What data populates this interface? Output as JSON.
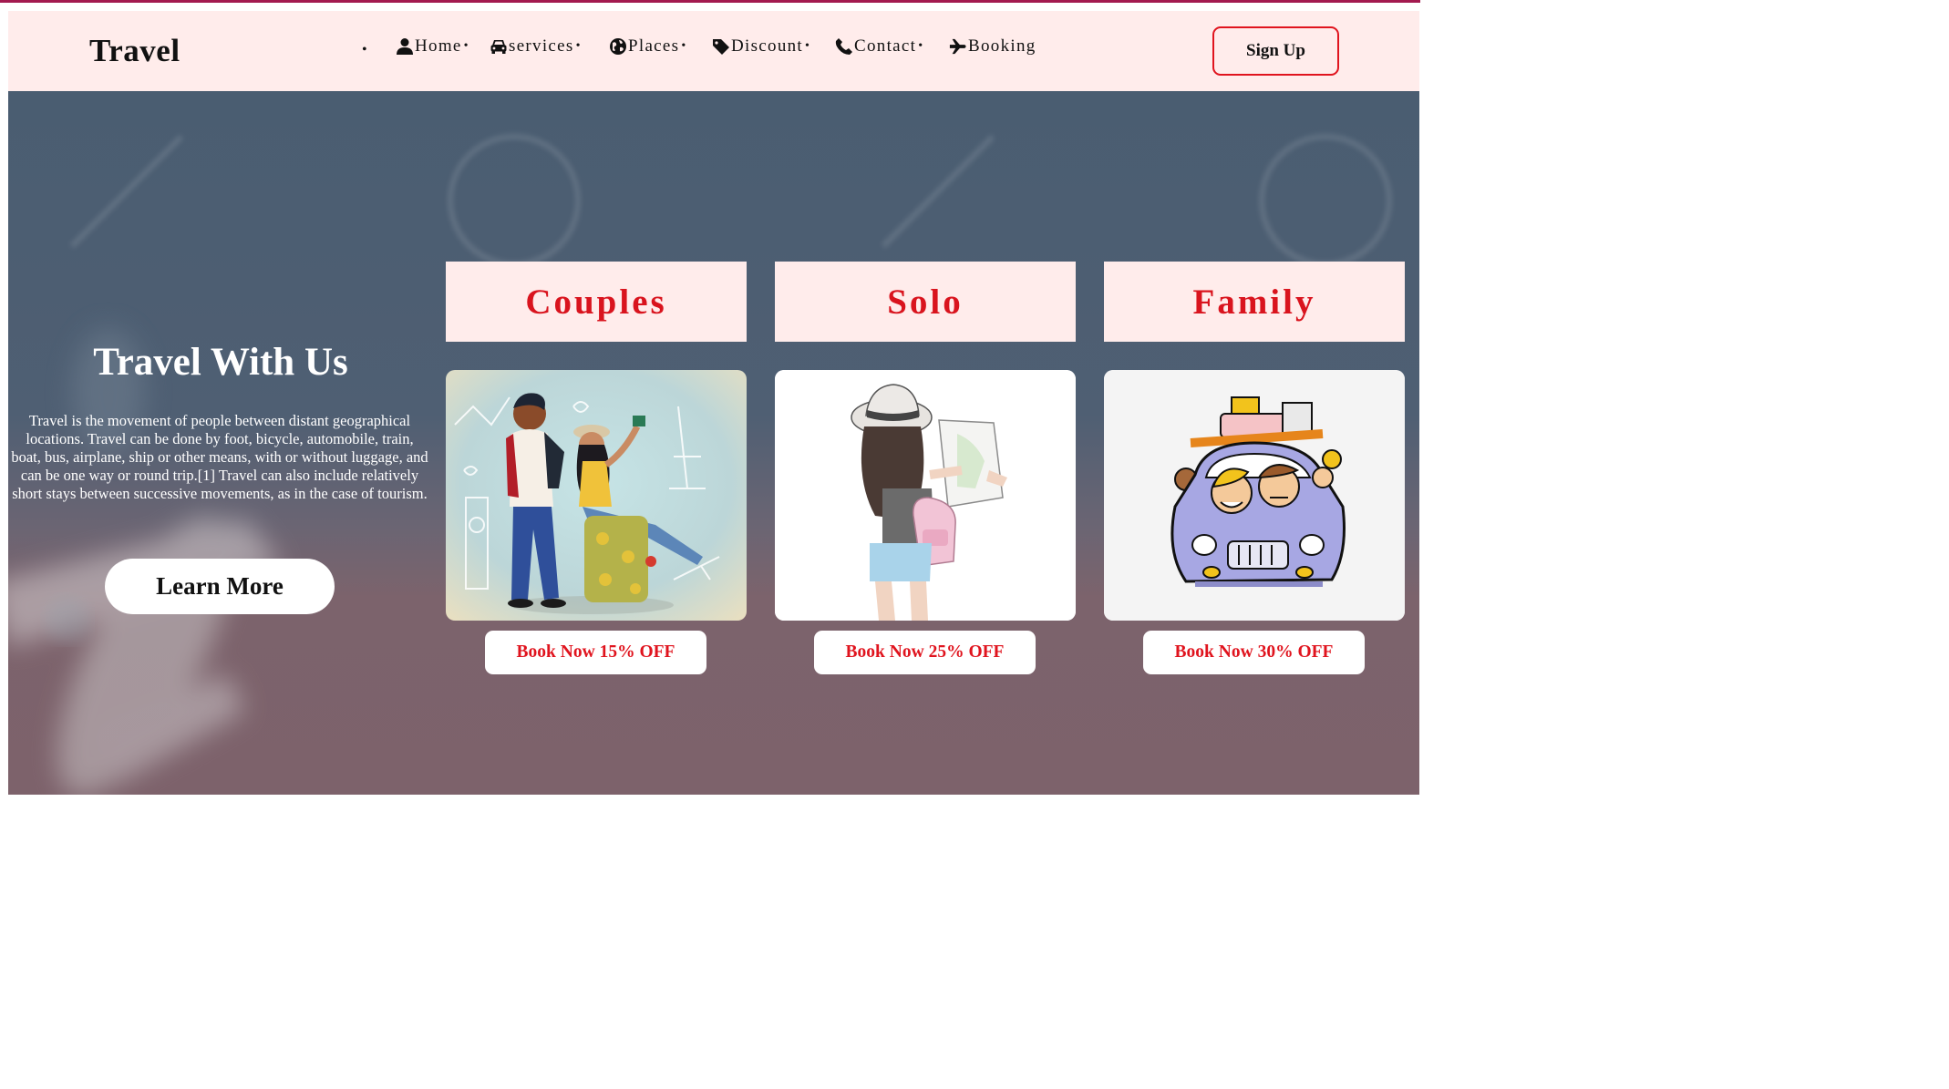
{
  "brand": "Travel",
  "nav": {
    "items": [
      {
        "label": "Home",
        "icon": "user-icon"
      },
      {
        "label": "services",
        "icon": "car-icon"
      },
      {
        "label": "Places",
        "icon": "globe-icon"
      },
      {
        "label": "Discount",
        "icon": "tag-icon"
      },
      {
        "label": "Contact",
        "icon": "phone-icon"
      },
      {
        "label": "Booking",
        "icon": "plane-icon"
      }
    ],
    "signup_label": "Sign Up"
  },
  "hero": {
    "title": "Travel With Us",
    "text": "Travel is the movement of people between distant geographical locations. Travel can be done by foot, bicycle, automobile, train, boat, bus, airplane, ship or other means, with or without luggage, and can be one way or round trip.[1] Travel can also include relatively short stays between successive movements, as in the case of tourism.",
    "button_label": "Learn More"
  },
  "cards": [
    {
      "title": "Couples",
      "button_label": "Book Now 15% OFF",
      "image": "couple-illustration"
    },
    {
      "title": "Solo",
      "button_label": "Book Now 25% OFF",
      "image": "solo-traveler-illustration"
    },
    {
      "title": "Family",
      "button_label": "Book Now 30% OFF",
      "image": "family-car-illustration"
    }
  ],
  "colors": {
    "accent": "#e0141e",
    "nav_bg": "#ffeceb",
    "top_border": "#a31a4f",
    "hero_top": "#4a5d71",
    "hero_bottom": "#7d626b"
  }
}
